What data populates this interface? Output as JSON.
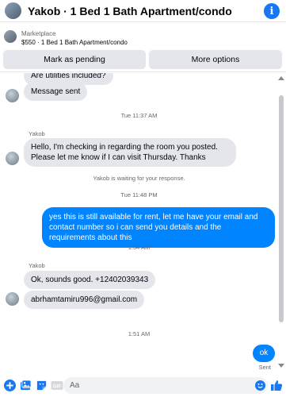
{
  "header": {
    "title": "Yakob · 1 Bed 1 Bath Apartment/condo",
    "info_glyph": "i"
  },
  "listing": {
    "source": "Marketplace",
    "description": "$550 · 1 Bed 1 Bath Apartment/condo",
    "pending_button": "Mark as pending",
    "more_button": "More options"
  },
  "conversation": {
    "clipped_top_message": "Are utilities included?",
    "message_sent": "Message sent",
    "time_1": "Tue 11:37 AM",
    "sender_1": "Yakob",
    "msg_checkin": "Hello, I'm checking in regarding the room you posted. Please let me know if I can visit Thursday. Thanks",
    "waiting_notice": "Yakob is waiting for your response.",
    "time_2": "Tue 11:48 PM",
    "msg_reply": "yes this is still available for rent, let me have your email  and contact number so i can send you details and the requirements about this",
    "time_3": "1:34 AM",
    "sender_2": "Yakob",
    "msg_phone": "Ok, sounds good. +12402039343",
    "msg_email": "abrhamtamiru996@gmail.com",
    "time_4": "1:51 AM",
    "msg_ok": "ok",
    "status_sent": "Sent"
  },
  "composer": {
    "placeholder": "Aa"
  },
  "colors": {
    "accent": "#1877f2",
    "outgoing_bubble": "#0084ff",
    "incoming_bubble": "#e4e6eb"
  }
}
